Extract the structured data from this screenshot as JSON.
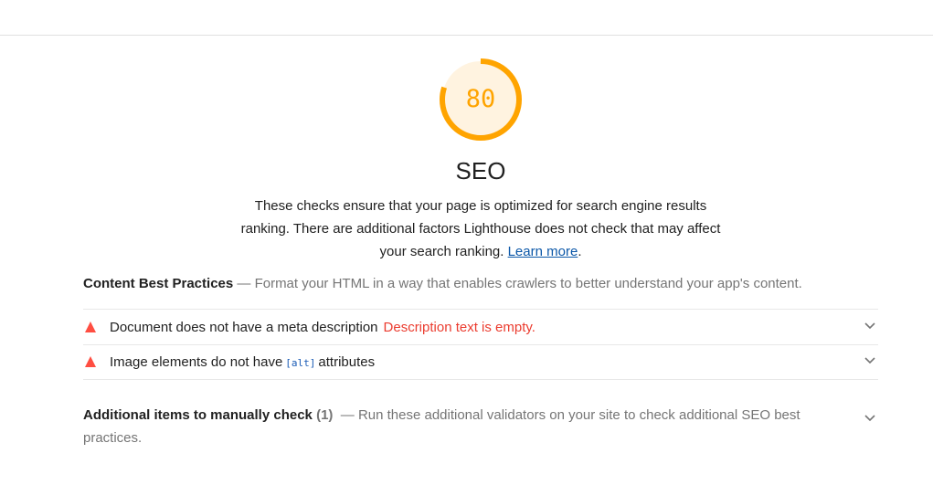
{
  "seo": {
    "score": "80",
    "score_value": 0.8,
    "title": "SEO",
    "description_text": "These checks ensure that your page is optimized for search engine results ranking. There are additional factors Lighthouse does not check that may affect your search ranking.",
    "learn_more_label": "Learn more",
    "period": "."
  },
  "group": {
    "title": "Content Best Practices",
    "separator": "—",
    "description": "Format your HTML in a way that enables crawlers to better understand your app's content."
  },
  "audits": [
    {
      "title": "Document does not have a meta description",
      "display_value": "Description text is empty.",
      "icon": "fail-triangle-icon"
    },
    {
      "title_prefix": "Image elements do not have",
      "code": "[alt]",
      "title_suffix": "attributes",
      "icon": "fail-triangle-icon"
    }
  ],
  "manual": {
    "title": "Additional items to manually check",
    "count": "(1)",
    "separator": "—",
    "description": "Run these additional validators on your site to check additional SEO best practices."
  },
  "colors": {
    "average": "#ffa400",
    "average_bg": "#fff3e0",
    "fail": "#ff4e42",
    "link": "#0b57a8"
  }
}
